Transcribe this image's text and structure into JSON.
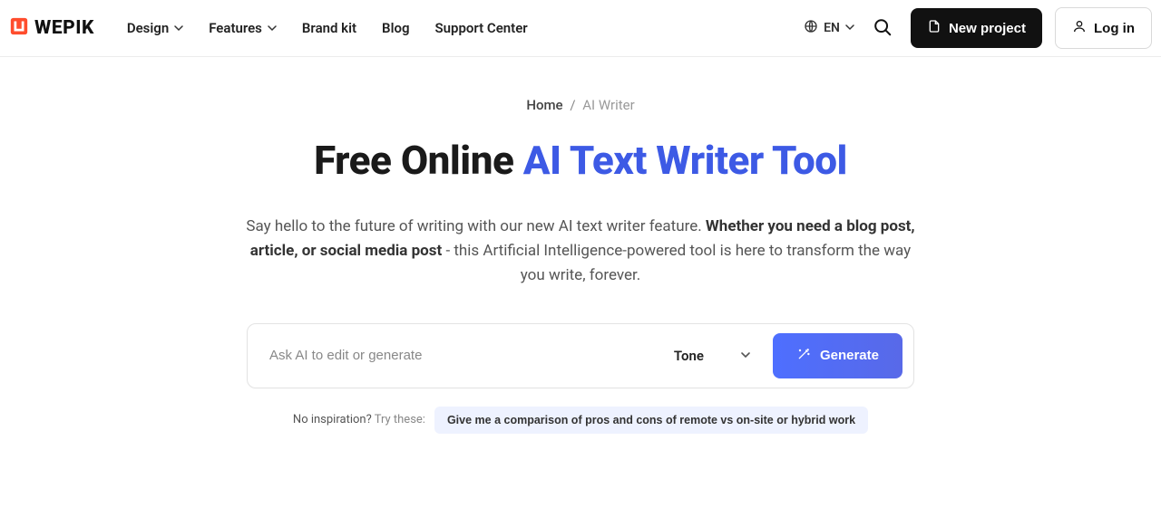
{
  "header": {
    "logo_text": "WEPIK",
    "nav": [
      {
        "label": "Design",
        "has_dropdown": true
      },
      {
        "label": "Features",
        "has_dropdown": true
      },
      {
        "label": "Brand kit",
        "has_dropdown": false
      },
      {
        "label": "Blog",
        "has_dropdown": false
      },
      {
        "label": "Support Center",
        "has_dropdown": false
      }
    ],
    "language": "EN",
    "new_project_label": "New project",
    "login_label": "Log in"
  },
  "breadcrumb": {
    "home": "Home",
    "sep": "/",
    "current": "AI Writer"
  },
  "title": {
    "prefix": "Free Online ",
    "accent": "AI Text Writer Tool"
  },
  "subtitle": {
    "part1": "Say hello to the future of writing with our new AI text writer feature. ",
    "bold": "Whether you need a blog post, article, or social media post",
    "part2": " - this Artificial Intelligence-powered tool is here to transform the way you write, forever."
  },
  "prompt": {
    "placeholder": "Ask AI to edit or generate",
    "tone_label": "Tone",
    "generate_label": "Generate"
  },
  "suggestions": {
    "label_bold": "No inspiration?",
    "label_light": " Try these:",
    "chip": "Give me a comparison of pros and cons of remote vs on-site or hybrid work"
  }
}
